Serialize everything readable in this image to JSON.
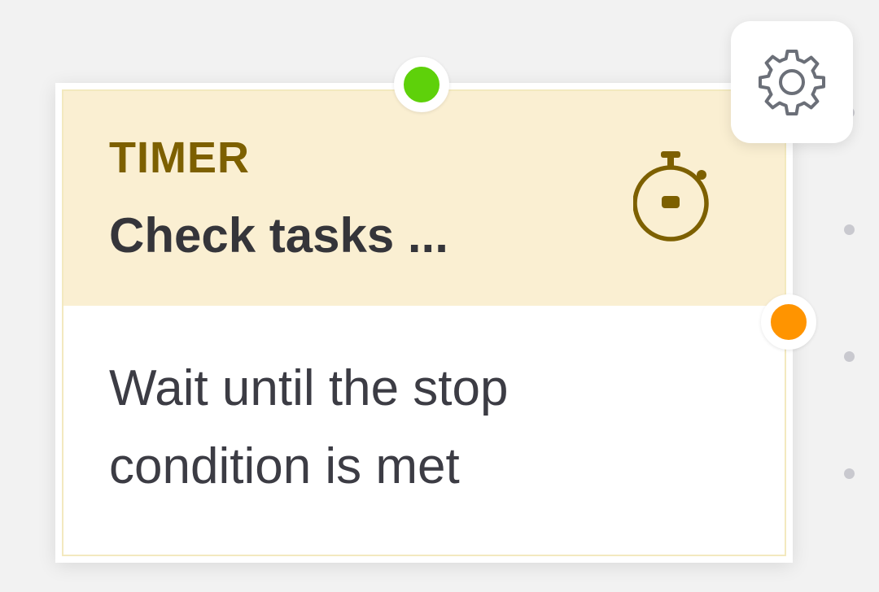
{
  "node": {
    "type_label": "TIMER",
    "title": "Check tasks ...",
    "description": "Wait until the stop condition is met",
    "icon": "stopwatch-icon",
    "accent_color": "#7d6000",
    "header_bg": "#faefd2"
  },
  "handles": {
    "input_color": "#5ed10a",
    "output_color": "#ff9400"
  },
  "toolbar": {
    "settings_icon": "gear-icon"
  }
}
